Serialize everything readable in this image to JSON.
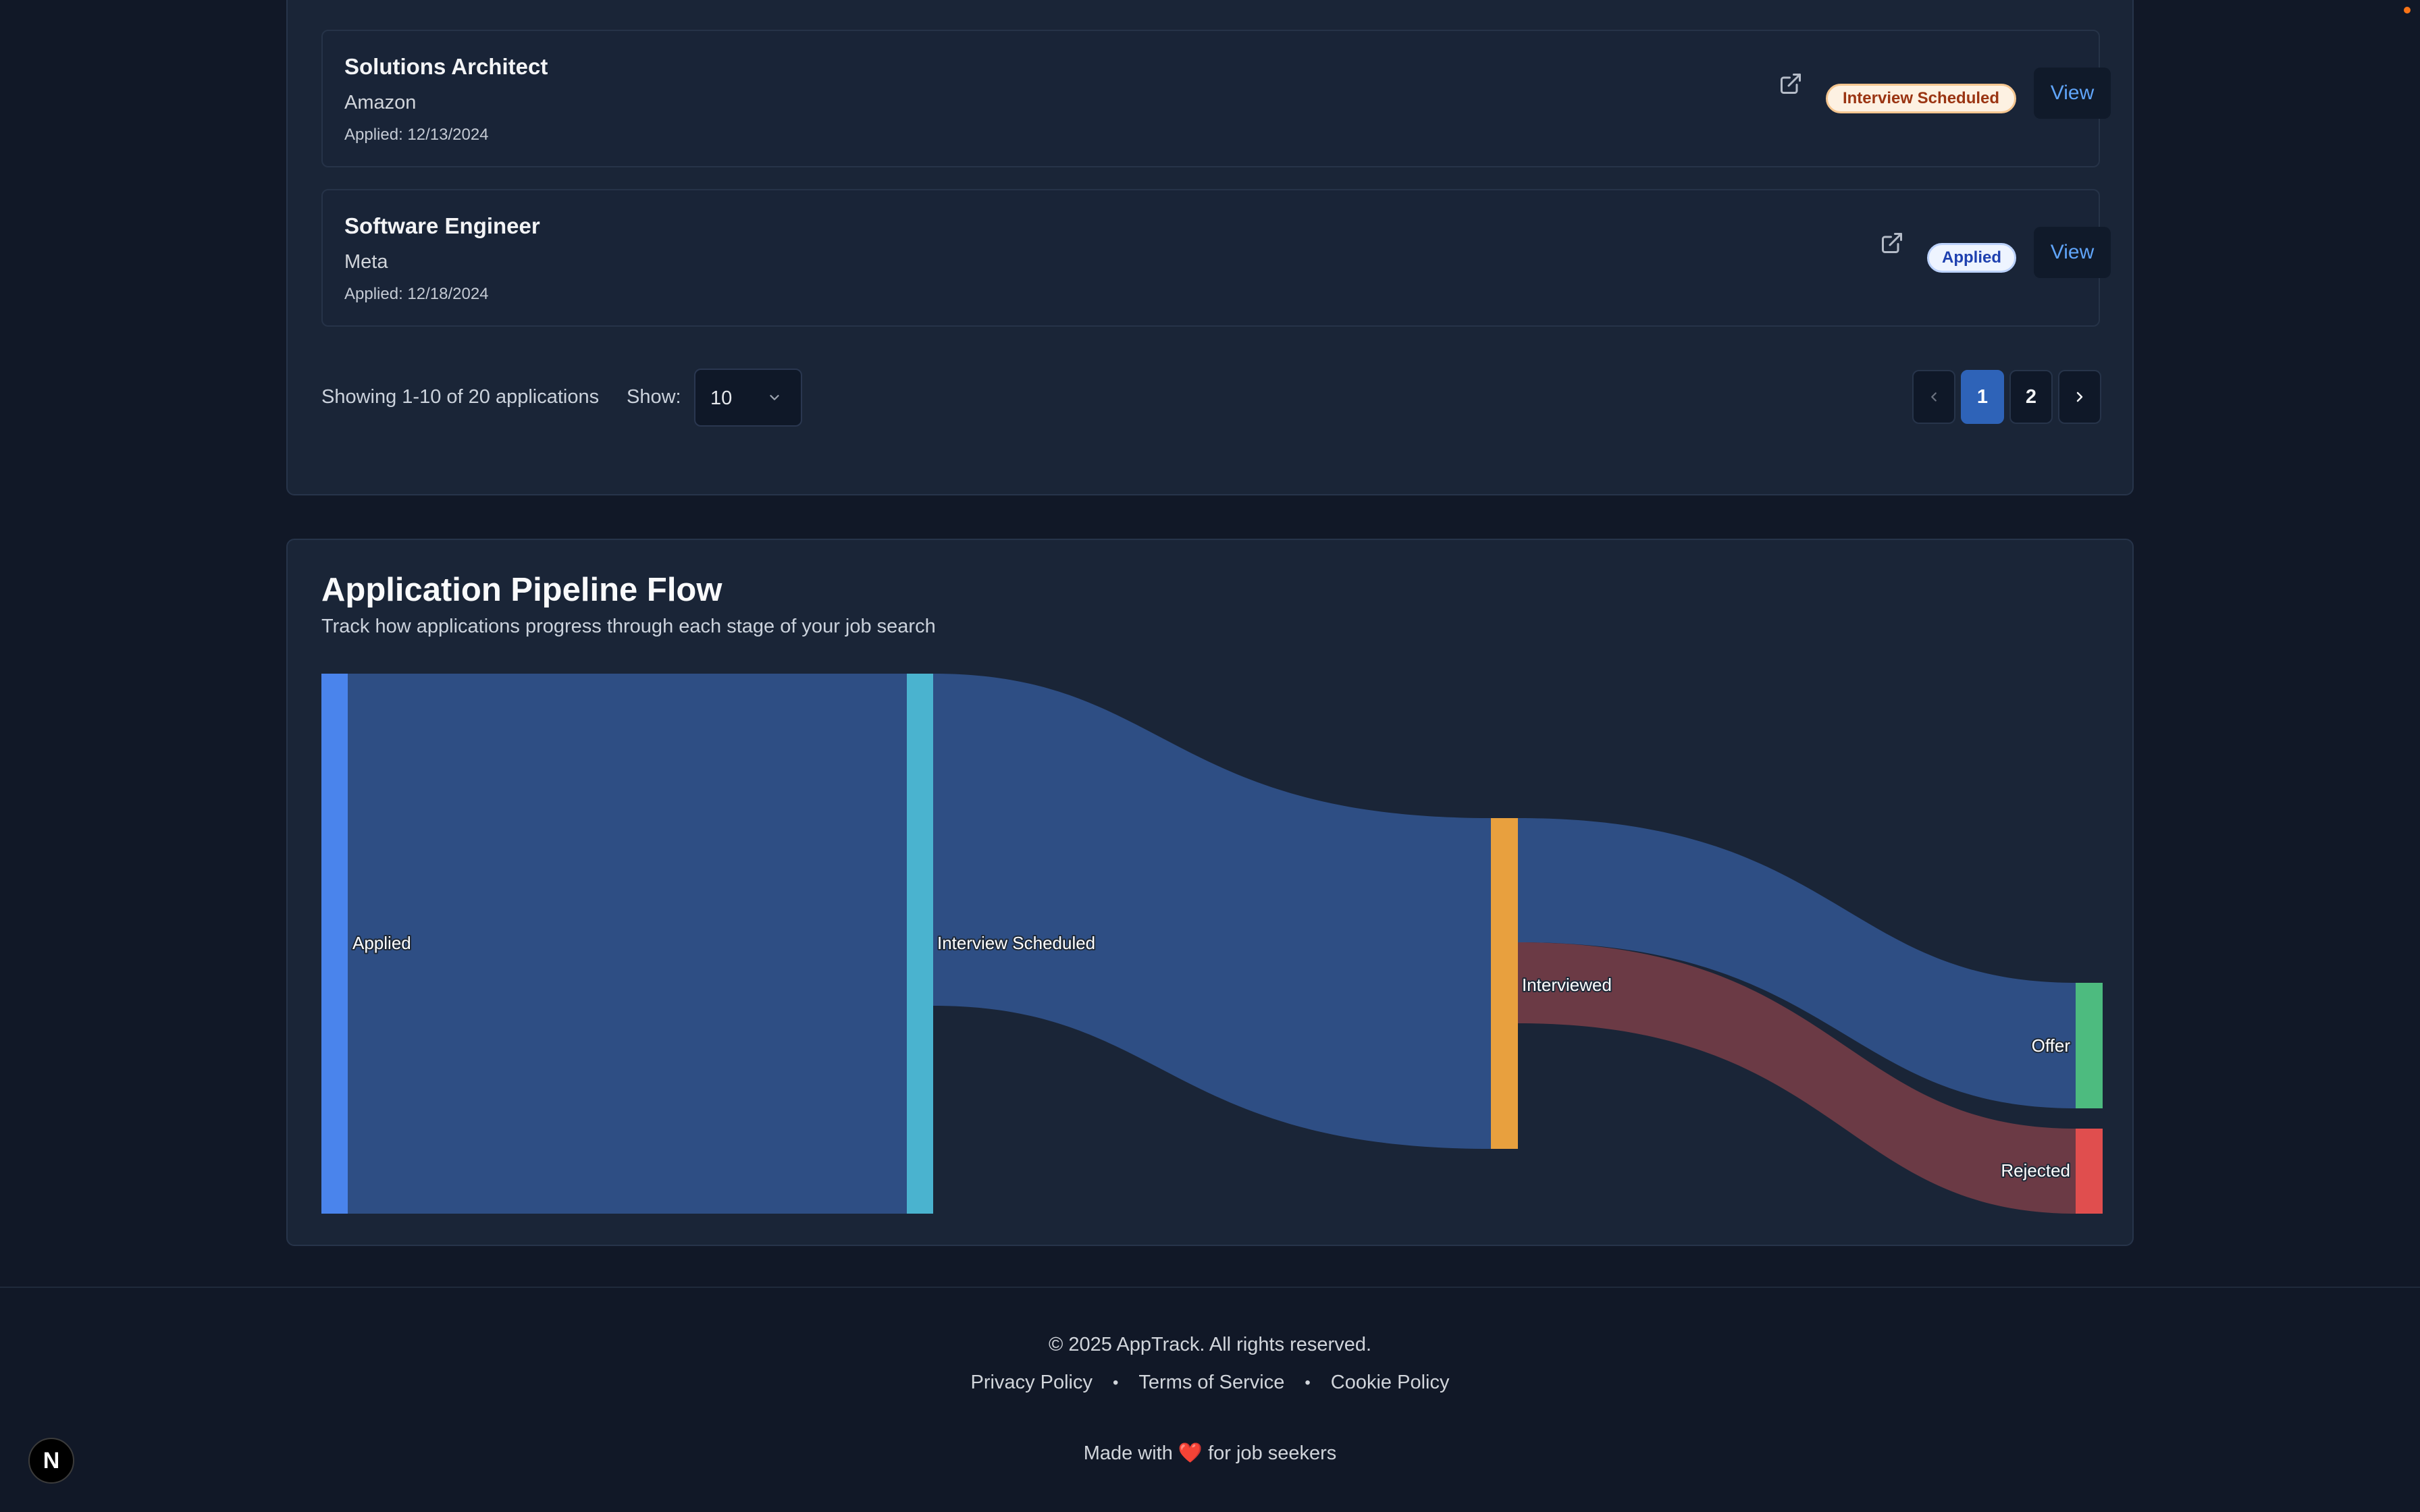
{
  "applications": [
    {
      "title": "Solutions Architect",
      "company": "Amazon",
      "applied": "Applied: 12/13/2024",
      "status": "Interview Scheduled",
      "view_label": "View"
    },
    {
      "title": "Software Engineer",
      "company": "Meta",
      "applied": "Applied: 12/18/2024",
      "status": "Applied",
      "view_label": "View"
    }
  ],
  "pagination": {
    "showing": "Showing 1-10 of 20 applications",
    "show_label": "Show:",
    "page_size": "10",
    "pages": [
      "1",
      "2"
    ],
    "current_page": "1"
  },
  "pipeline": {
    "title": "Application Pipeline Flow",
    "subtitle": "Track how applications progress through each stage of your job search",
    "nodes": [
      {
        "name": "Applied",
        "color": "#4a84ec"
      },
      {
        "name": "Interview Scheduled",
        "color": "#4ab3cf"
      },
      {
        "name": "Interviewed",
        "color": "#e8a03e"
      },
      {
        "name": "Offer",
        "color": "#4dbb7f"
      },
      {
        "name": "Rejected",
        "color": "#e04e4e"
      }
    ],
    "links": [
      {
        "source": "Applied",
        "target": "Interview Scheduled",
        "value": 20
      },
      {
        "source": "Interview Scheduled",
        "target": "Interviewed",
        "value": 12.3
      },
      {
        "source": "Interviewed",
        "target": "Offer",
        "value": 4.6
      },
      {
        "source": "Interviewed",
        "target": "Rejected",
        "value": 3
      }
    ],
    "link_colors": {
      "default": "#2e4e84",
      "rejected": "#6b3a45"
    }
  },
  "footer": {
    "copyright": "© 2025 AppTrack. All rights reserved.",
    "links": [
      "Privacy Policy",
      "Terms of Service",
      "Cookie Policy"
    ],
    "made_with_prefix": "Made with",
    "heart": "❤️",
    "made_with_suffix": "for job seekers",
    "next_badge": "N"
  }
}
